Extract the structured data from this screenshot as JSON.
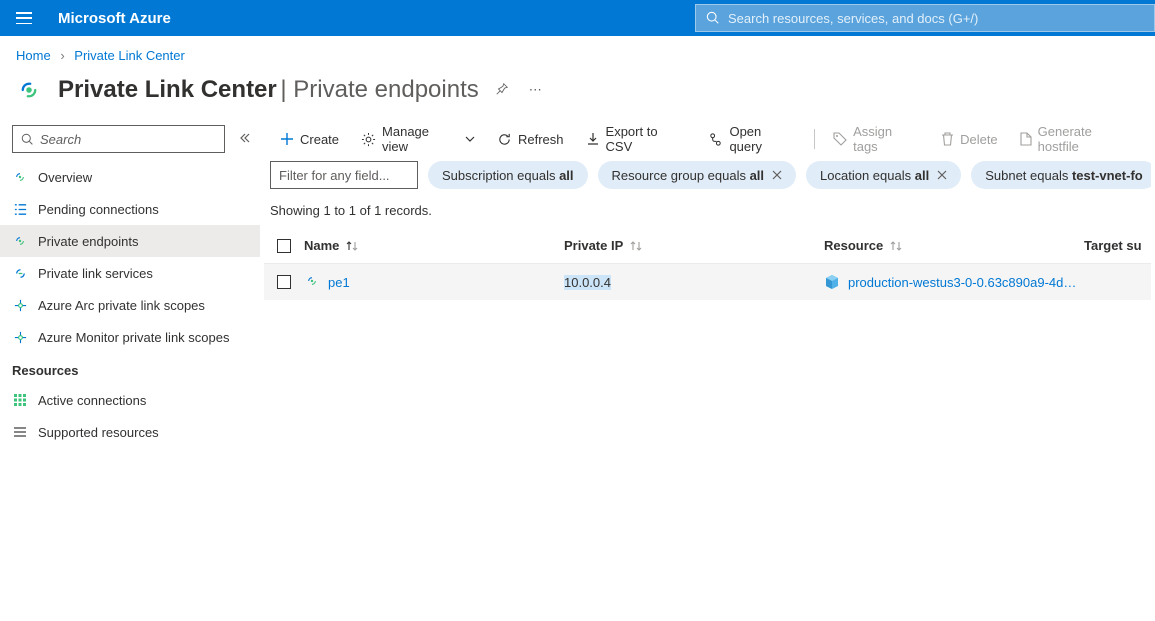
{
  "topbar": {
    "brand": "Microsoft Azure",
    "search_placeholder": "Search resources, services, and docs (G+/)"
  },
  "breadcrumbs": {
    "home": "Home",
    "current": "Private Link Center"
  },
  "header": {
    "title": "Private Link Center",
    "subtitle": "Private endpoints"
  },
  "sidebar": {
    "search_placeholder": "Search",
    "items": [
      {
        "label": "Overview"
      },
      {
        "label": "Pending connections"
      },
      {
        "label": "Private endpoints"
      },
      {
        "label": "Private link services"
      },
      {
        "label": "Azure Arc private link scopes"
      },
      {
        "label": "Azure Monitor private link scopes"
      }
    ],
    "section_label": "Resources",
    "resource_items": [
      {
        "label": "Active connections"
      },
      {
        "label": "Supported resources"
      }
    ]
  },
  "toolbar": {
    "create": "Create",
    "manage_view": "Manage view",
    "refresh": "Refresh",
    "export_csv": "Export to CSV",
    "open_query": "Open query",
    "assign_tags": "Assign tags",
    "delete": "Delete",
    "generate_hostfile": "Generate hostfile"
  },
  "filters": {
    "input_placeholder": "Filter for any field...",
    "pills": [
      {
        "prefix": "Subscription equals ",
        "value": "all",
        "closable": false
      },
      {
        "prefix": "Resource group equals ",
        "value": "all",
        "closable": true
      },
      {
        "prefix": "Location equals ",
        "value": "all",
        "closable": true
      },
      {
        "prefix": "Subnet equals ",
        "value": "test-vnet-fo",
        "closable": false
      }
    ]
  },
  "records_info": "Showing 1 to 1 of 1 records.",
  "table": {
    "columns": {
      "name": "Name",
      "private_ip": "Private IP",
      "resource": "Resource",
      "target": "Target su"
    },
    "rows": [
      {
        "name": "pe1",
        "private_ip": "10.0.0.4",
        "resource": "production-westus3-0-0.63c890a9-4d…"
      }
    ]
  }
}
